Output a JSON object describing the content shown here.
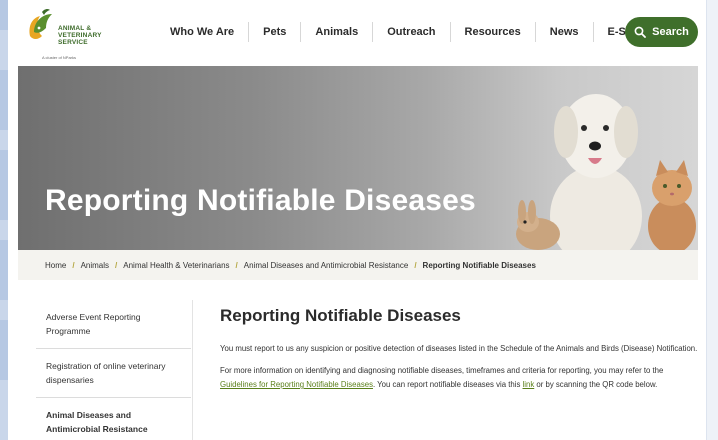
{
  "brand": {
    "line1": "ANIMAL &",
    "line2": "VETERINARY",
    "line3": "SERVICE",
    "tagline": "A cluster of NParks"
  },
  "nav": {
    "items": [
      "Who We Are",
      "Pets",
      "Animals",
      "Outreach",
      "Resources",
      "News",
      "E-Services"
    ],
    "search_label": "Search",
    "accent_color": "#3f6f2b"
  },
  "hero": {
    "title": "Reporting Notifiable Diseases"
  },
  "breadcrumb": {
    "items": [
      "Home",
      "Animals",
      "Animal Health & Veterinarians",
      "Animal Diseases and Antimicrobial Resistance"
    ],
    "current": "Reporting Notifiable Diseases"
  },
  "sidebar": {
    "items": [
      {
        "label": "Adverse Event Reporting Programme"
      },
      {
        "label": "Registration of online veterinary dispensaries"
      },
      {
        "label": "Animal Diseases and Antimicrobial Resistance"
      }
    ]
  },
  "main": {
    "title": "Reporting Notifiable Diseases",
    "para1": "You must report to us any suspicion or positive detection of diseases listed in the Schedule of the Animals and Birds (Disease) Notification.",
    "para2_pre": "For more information on identifying and diagnosing notifiable diseases, timeframes and criteria for reporting, you may refer to the ",
    "para2_link1": "Guidelines for Reporting Notifiable Diseases",
    "para2_mid": ". You can report notifiable diseases via this ",
    "para2_link2": "link",
    "para2_post": " or by scanning the QR code below."
  }
}
